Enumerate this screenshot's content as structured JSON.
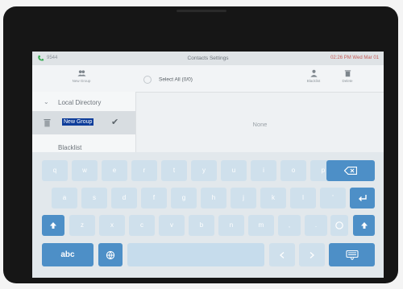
{
  "status": {
    "extension": "9544",
    "title": "Contacts Settings",
    "datetime": "02:26 PM Wed Mar 01"
  },
  "toolbar": {
    "new_group": "New Group",
    "select_all": "Select All (0/0)",
    "blacklist": "Blacklist",
    "delete": "Delete"
  },
  "sidebar": {
    "local_directory": "Local Directory",
    "new_group_item": "New Group",
    "blacklist": "Blacklist"
  },
  "content": {
    "empty": "None"
  },
  "keyboard": {
    "row1": [
      "q",
      "w",
      "e",
      "r",
      "t",
      "y",
      "u",
      "i",
      "o",
      "p"
    ],
    "row2": [
      "a",
      "s",
      "d",
      "f",
      "g",
      "h",
      "j",
      "k",
      "l",
      "'"
    ],
    "row3": [
      "z",
      "x",
      "c",
      "v",
      "b",
      "n",
      "m",
      ",",
      "."
    ],
    "abc_label": "abc",
    "accent": "#4d8fc7"
  }
}
